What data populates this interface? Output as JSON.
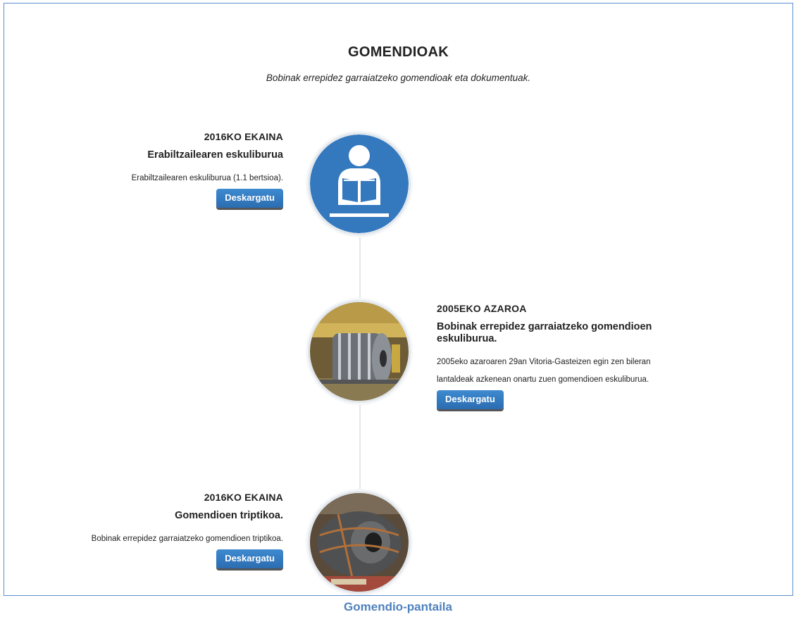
{
  "header": {
    "title": "GOMENDIOAK",
    "subtitle": "Bobinak errepidez garraiatzeko gomendioak eta dokumentuak."
  },
  "items": [
    {
      "date": "2016KO EKAINA",
      "heading": "Erabiltzailearen eskuliburua",
      "description": "Erabiltzailearen eskuliburua (1.1 bertsioa).",
      "button": "Deskargatu",
      "icon": "reader-icon"
    },
    {
      "date": "2005EKO AZAROA",
      "heading": "Bobinak errepidez garraiatzeko gomendioen eskuliburua.",
      "description": "2005eko azaroaren 29an Vitoria-Gasteizen egin zen bileran lantaldeak azkenean onartu zuen gomendioen eskuliburua.",
      "button": "Deskargatu",
      "icon": "steel-coil-photo"
    },
    {
      "date": "2016KO EKAINA",
      "heading": "Gomendioen triptikoa.",
      "description": "Bobinak errepidez garraiatzeko gomendioen triptikoa.",
      "button": "Deskargatu",
      "icon": "steel-coil-photo"
    }
  ],
  "caption": "Gomendio-pantaila",
  "colors": {
    "accent": "#3478be",
    "border": "#5b8fd1",
    "caption": "#4f81bd"
  }
}
